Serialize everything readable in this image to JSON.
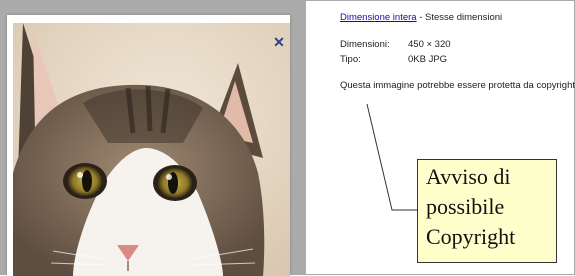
{
  "details": {
    "link_label": "Dimensione intera",
    "title_suffix": " - Stesse dimensioni",
    "dimensions_label": "Dimensioni:",
    "dimensions_value": "450 × 320",
    "type_label": "Tipo:",
    "type_value": "0KB JPG",
    "notice": "Questa immagine potrebbe essere protetta da copyright."
  },
  "callout": {
    "line1": "Avviso di",
    "line2": "possibile",
    "line3": "Copyright"
  },
  "icons": {
    "close": "close-icon"
  },
  "colors": {
    "link": "#1a0dab",
    "close_icon": "#2a3f8f",
    "callout_bg": "#ffffcc",
    "left_panel_bg": "#ababab"
  }
}
